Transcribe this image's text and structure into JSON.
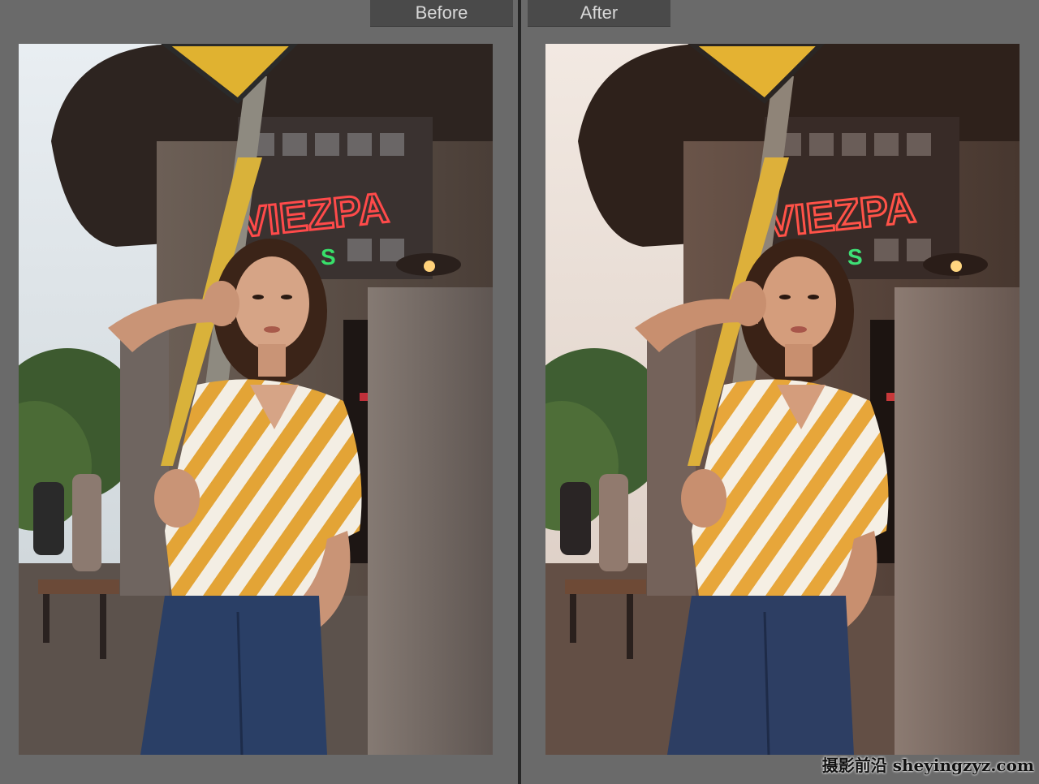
{
  "compare": {
    "before_label": "Before",
    "after_label": "After"
  },
  "photo": {
    "sign_text": "VIEZPA",
    "sign_green_text": "S"
  },
  "watermark": {
    "text": "摄影前沿 sheyingzyz.com"
  },
  "colors": {
    "background": "#6b6b6b",
    "tab": "#4a4a4a",
    "divider": "#262626",
    "neon_red": "#ff4a4a",
    "shirt_yellow": "#e7a63a"
  }
}
